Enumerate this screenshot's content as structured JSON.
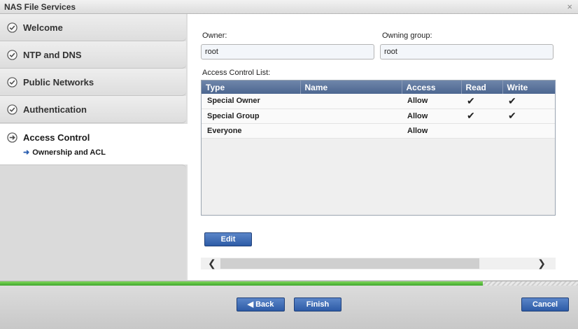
{
  "window": {
    "title": "NAS File Services",
    "close_glyph": "×"
  },
  "sidebar": {
    "steps": [
      {
        "label": "Welcome",
        "state": "done",
        "icon": "check-circle-icon"
      },
      {
        "label": "NTP and DNS",
        "state": "done",
        "icon": "check-circle-icon"
      },
      {
        "label": "Public Networks",
        "state": "done",
        "icon": "check-circle-icon"
      },
      {
        "label": "Authentication",
        "state": "done",
        "icon": "check-circle-icon"
      },
      {
        "label": "Access Control",
        "state": "active",
        "icon": "arrow-circle-icon",
        "substep": {
          "label": "Ownership and ACL",
          "icon": "arrow-right-icon"
        }
      }
    ]
  },
  "form": {
    "owner": {
      "label": "Owner:",
      "value": "root"
    },
    "owning_group": {
      "label": "Owning group:",
      "value": "root"
    },
    "acl_label": "Access Control List:"
  },
  "acl": {
    "columns": [
      "Type",
      "Name",
      "Access",
      "Read",
      "Write"
    ],
    "rows": [
      {
        "type": "Special Owner",
        "name": "",
        "access": "Allow",
        "read": "✔",
        "write": "✔"
      },
      {
        "type": "Special Group",
        "name": "",
        "access": "Allow",
        "read": "✔",
        "write": "✔"
      },
      {
        "type": "Everyone",
        "name": "",
        "access": "Allow",
        "read": "",
        "write": ""
      }
    ]
  },
  "buttons": {
    "edit": "Edit",
    "back": "◀ Back",
    "finish": "Finish",
    "cancel": "Cancel"
  },
  "scrollbar": {
    "left_glyph": "❮",
    "right_glyph": "❯"
  },
  "progress": {
    "fraction": 0.835
  },
  "colors": {
    "accent": "#2d5ba6",
    "progress": "#3fa52c",
    "header": "#4c6690"
  }
}
